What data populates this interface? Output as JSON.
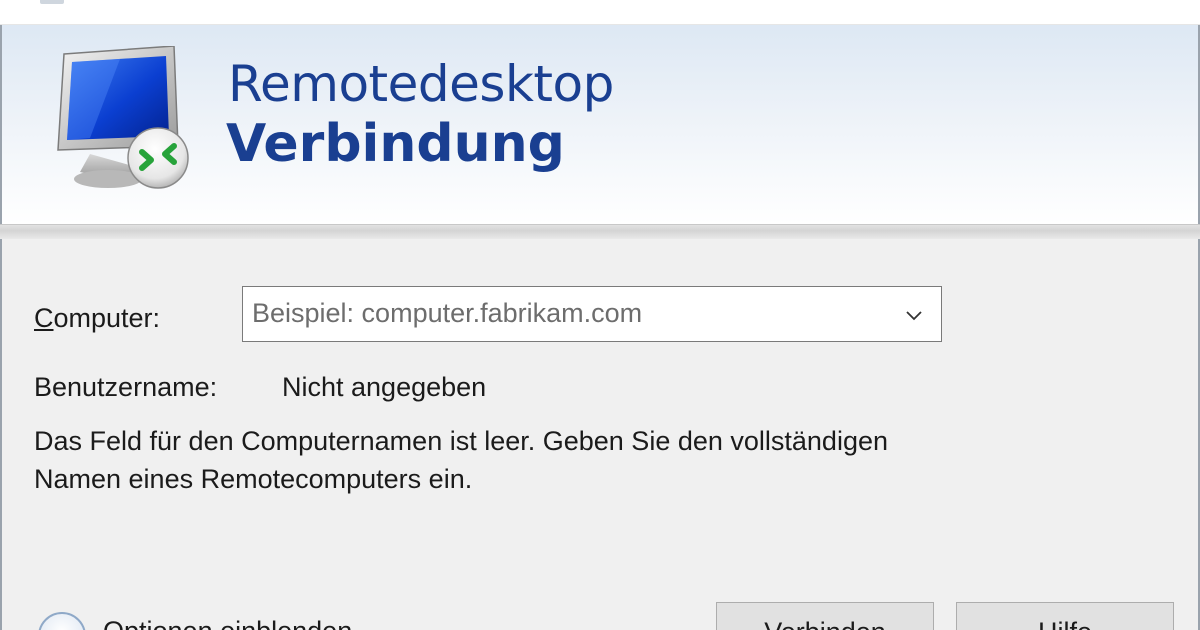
{
  "window": {
    "title_caption": "Remotedesktopverbindung"
  },
  "header": {
    "title_line1": "Remotedesktop",
    "title_line2": "Verbindung",
    "logo_icon": "remote-desktop-monitor-icon"
  },
  "form": {
    "computer_label_mnemonic": "C",
    "computer_label_rest": "omputer:",
    "computer_input_value": "",
    "computer_input_placeholder": "Beispiel: computer.fabrikam.com",
    "dropdown_icon": "chevron-down-icon",
    "username_label": "Benutzername:",
    "username_value": "Nicht angegeben",
    "message": "Das Feld für den Computernamen ist leer. Geben Sie den vollständigen Namen eines Remotecomputers ein."
  },
  "footer": {
    "options_label": "Optionen einblenden",
    "connect_button": "Verbinden",
    "help_button": "Hilfe"
  },
  "colors": {
    "title_blue": "#1a3f91",
    "body_background": "#f0f0f0",
    "button_background": "#e1e1e1"
  }
}
